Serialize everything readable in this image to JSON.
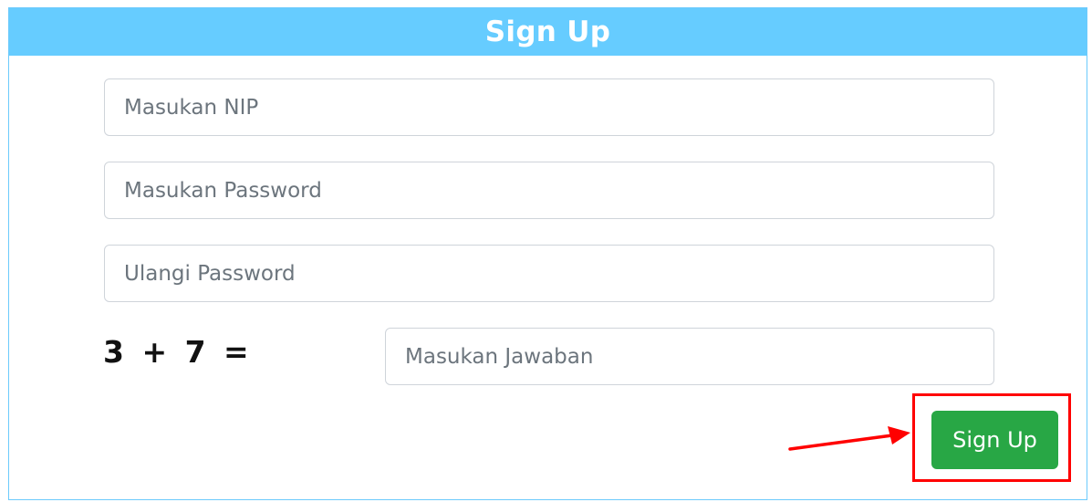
{
  "form": {
    "title": "Sign Up",
    "nip_placeholder": "Masukan NIP",
    "password_placeholder": "Masukan Password",
    "repeat_password_placeholder": "Ulangi Password",
    "captcha_question": "3 + 7 =",
    "captcha_placeholder": "Masukan Jawaban",
    "submit_label": "Sign Up"
  },
  "colors": {
    "header": "#66ccff",
    "submit": "#28a745",
    "highlight": "#ff0000"
  },
  "annotation": {
    "arrow_icon": "arrow-right-icon"
  }
}
